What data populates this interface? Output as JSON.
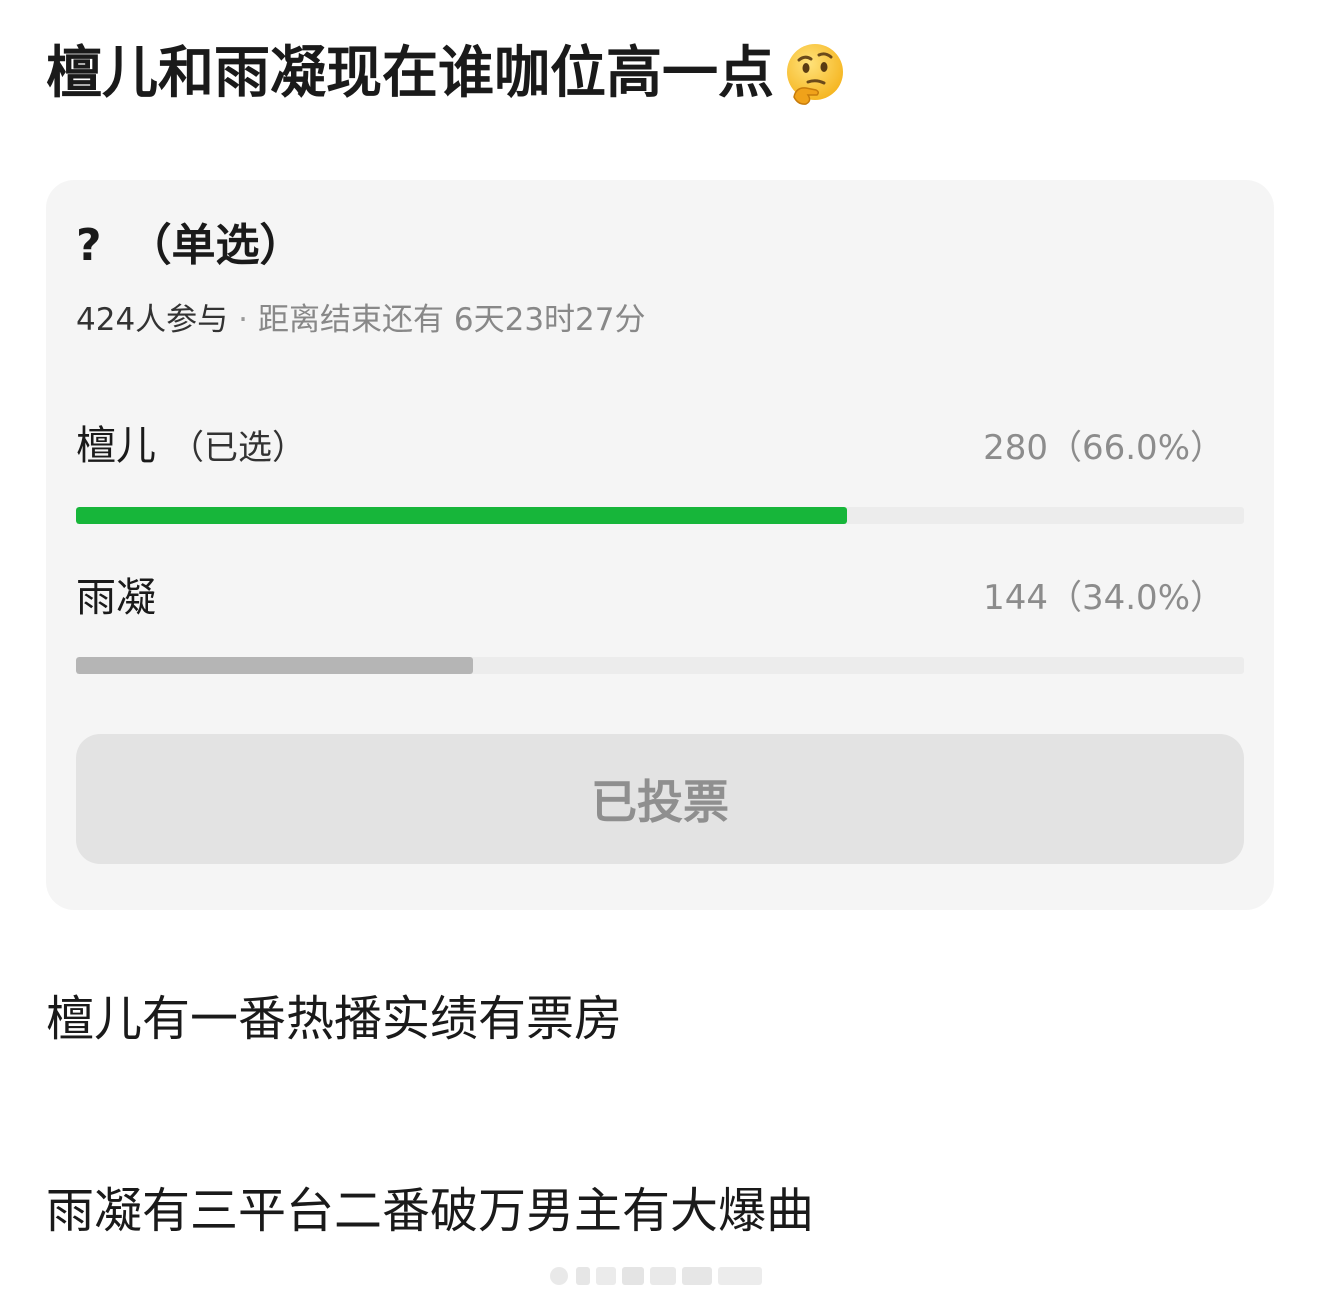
{
  "post": {
    "title": "檀儿和雨凝现在谁咖位高一点",
    "title_emoji": "thinking-face-icon"
  },
  "poll": {
    "question_mark": "?",
    "question_type": "（单选）",
    "participants": "424人参与",
    "separator": "·",
    "deadline": "距离结束还有 6天23时27分",
    "options": [
      {
        "label": "檀儿",
        "selected_tag": "（已选）",
        "count_text": "280（66.0%）",
        "percent": 66.0,
        "bar_color": "#17b63a"
      },
      {
        "label": "雨凝",
        "selected_tag": "",
        "count_text": "144（34.0%）",
        "percent": 34.0,
        "bar_color": "#b5b5b5"
      }
    ],
    "vote_button_label": "已投票"
  },
  "body": {
    "lines": [
      "檀儿有一番热播实绩有票房",
      "雨凝有三平台二番破万男主有大爆曲"
    ]
  },
  "colors": {
    "accent_green": "#17b63a",
    "bar_gray": "#b5b5b5",
    "card_bg": "#f5f5f5"
  }
}
